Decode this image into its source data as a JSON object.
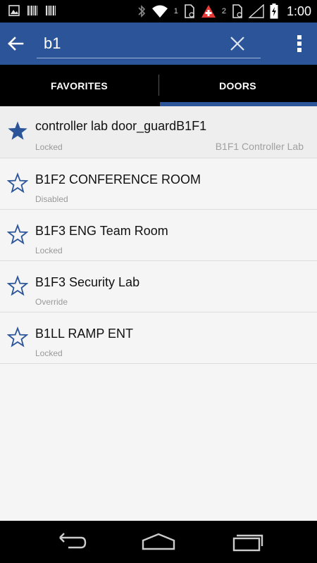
{
  "status_bar": {
    "left_icons": [
      "image-icon",
      "barcode-icon",
      "barcode-icon"
    ],
    "right_icons": [
      "bluetooth-icon",
      "wifi-icon",
      "sim-card-icon",
      "medical-alert-icon",
      "sim-card-icon",
      "cell-signal-icon",
      "battery-charging-icon"
    ],
    "sim1_label": "1",
    "sim2_label": "2",
    "time": "1:00"
  },
  "app_bar": {
    "color": "#2c5599",
    "search": {
      "value": "b1",
      "placeholder": ""
    }
  },
  "tabs": [
    {
      "label": "FAVORITES",
      "selected": false
    },
    {
      "label": "DOORS",
      "selected": true
    }
  ],
  "doors": [
    {
      "name": "controller lab door_guardB1F1",
      "status": "Locked",
      "location": "B1F1 Controller Lab",
      "favorite": true
    },
    {
      "name": "B1F2 CONFERENCE ROOM",
      "status": "Disabled",
      "location": "",
      "favorite": false
    },
    {
      "name": "B1F3 ENG Team Room",
      "status": "Locked",
      "location": "",
      "favorite": false
    },
    {
      "name": "B1F3 Security Lab",
      "status": "Override",
      "location": "",
      "favorite": false
    },
    {
      "name": "B1LL RAMP ENT",
      "status": "Locked",
      "location": "",
      "favorite": false
    }
  ],
  "nav_bar": {
    "buttons": [
      "back-icon",
      "home-icon",
      "recents-icon"
    ]
  }
}
